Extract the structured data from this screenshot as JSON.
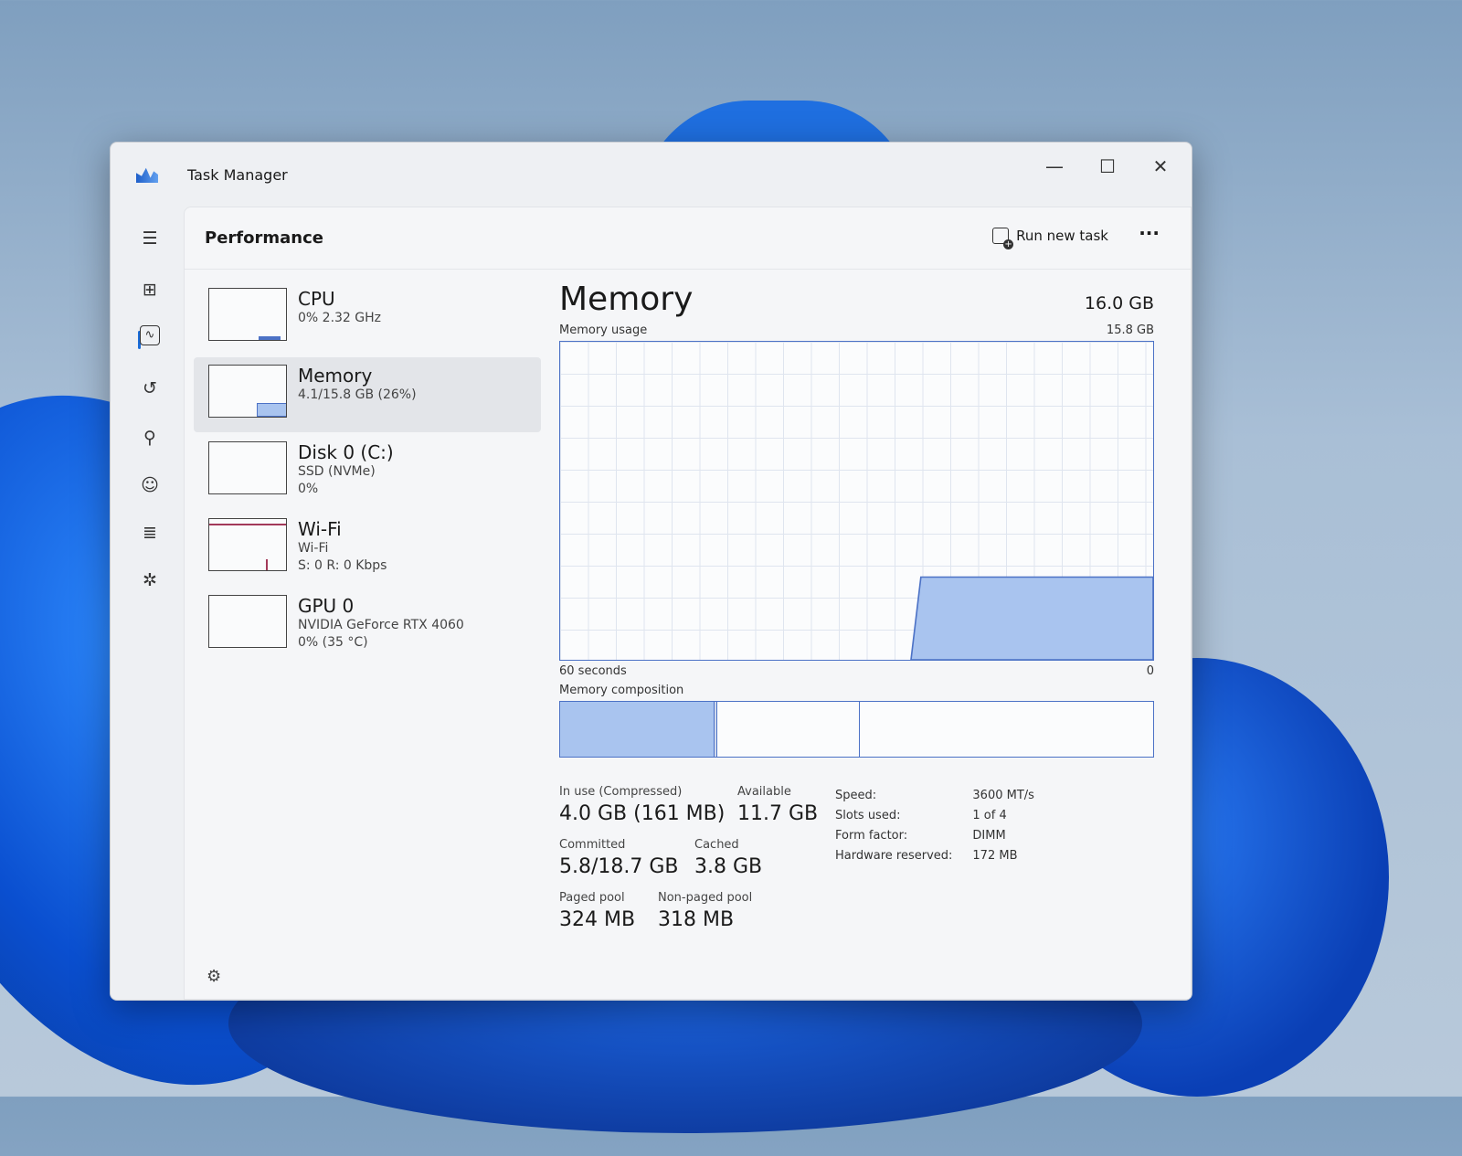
{
  "window": {
    "title": "Task Manager",
    "minimize": "—",
    "maximize": "☐",
    "close": "✕"
  },
  "nav": {
    "icons": [
      "hamburger-icon",
      "processes-icon",
      "performance-icon",
      "app-history-icon",
      "startup-icon",
      "users-icon",
      "details-icon",
      "services-icon",
      "settings-icon"
    ]
  },
  "header": {
    "title": "Performance",
    "run_new_task": "Run new task",
    "more": "···"
  },
  "devices": [
    {
      "name": "CPU",
      "line1": "0% 2.32 GHz",
      "line2": ""
    },
    {
      "name": "Memory",
      "line1": "4.1/15.8 GB (26%)",
      "line2": ""
    },
    {
      "name": "Disk 0 (C:)",
      "line1": "SSD (NVMe)",
      "line2": "0%"
    },
    {
      "name": "Wi-Fi",
      "line1": "Wi-Fi",
      "line2": "S: 0 R: 0 Kbps"
    },
    {
      "name": "GPU 0",
      "line1": "NVIDIA GeForce RTX 4060",
      "line2": "0% (35 °C)"
    }
  ],
  "memory": {
    "title": "Memory",
    "total": "16.0 GB",
    "usage_label": "Memory usage",
    "usage_max": "15.8 GB",
    "time_label": "60 seconds",
    "time_zero": "0",
    "composition_label": "Memory composition",
    "usage_percent": 26,
    "composition": {
      "in_use_percent": 26,
      "modified_percent": 0.5,
      "standby_percent": 24,
      "free_percent": 49.5
    },
    "stats": {
      "in_use_label": "In use (Compressed)",
      "in_use": "4.0 GB (161 MB)",
      "available_label": "Available",
      "available": "11.7 GB",
      "committed_label": "Committed",
      "committed": "5.8/18.7 GB",
      "cached_label": "Cached",
      "cached": "3.8 GB",
      "paged_label": "Paged pool",
      "paged": "324 MB",
      "nonpaged_label": "Non-paged pool",
      "nonpaged": "318 MB"
    },
    "hardware": [
      {
        "k": "Speed:",
        "v": "3600 MT/s"
      },
      {
        "k": "Slots used:",
        "v": "1 of 4"
      },
      {
        "k": "Form factor:",
        "v": "DIMM"
      },
      {
        "k": "Hardware reserved:",
        "v": "172 MB"
      }
    ]
  }
}
